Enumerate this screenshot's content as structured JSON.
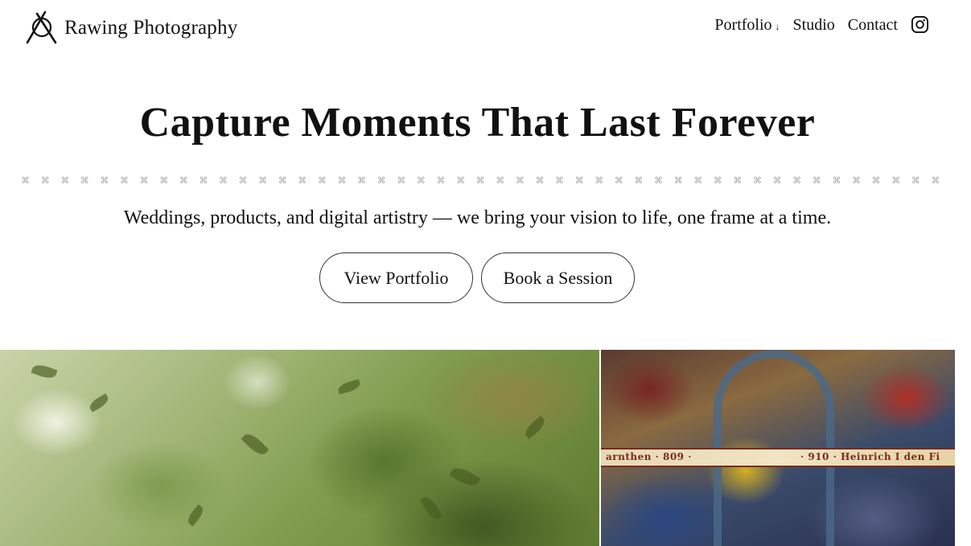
{
  "brand": {
    "name": "Rawing Photography",
    "logo_icon": "camera-aperture-logo-icon"
  },
  "nav": {
    "items": [
      {
        "label": "Portfolio",
        "has_dropdown": true,
        "caret": "↓"
      },
      {
        "label": "Studio"
      },
      {
        "label": "Contact"
      }
    ],
    "social_icon": "instagram-icon"
  },
  "hero": {
    "title": "Capture Moments That Last Forever",
    "divider_glyph": "⌘",
    "subtitle": "Weddings, products, and digital artistry — we bring your vision to life, one frame at a time.",
    "buttons": {
      "primary": "View Portfolio",
      "secondary": "Book a Session"
    }
  },
  "gallery": {
    "mural_left_text": "arnthen · 809 ·",
    "mural_right_text": "· 910 · Heinrich I den Fi"
  },
  "colors": {
    "text": "#111111",
    "background": "#ffffff",
    "divider_glyph": "#a9a9a9"
  }
}
